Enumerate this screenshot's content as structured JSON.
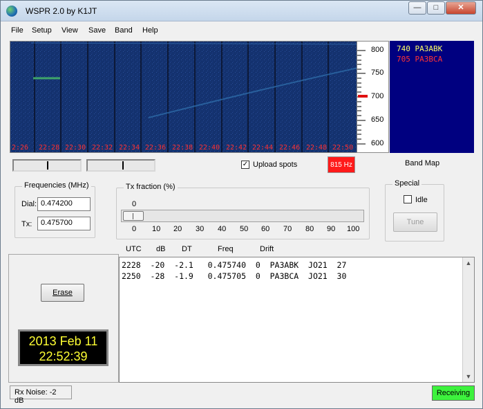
{
  "window": {
    "title": "WSPR 2.0    by K1JT"
  },
  "menu": [
    "File",
    "Setup",
    "View",
    "Save",
    "Band",
    "Help"
  ],
  "waterfall": {
    "time_labels": [
      "2:26",
      "22:28",
      "22:30",
      "22:32",
      "22:34",
      "22:36",
      "22:38",
      "22:40",
      "22:42",
      "22:44",
      "22:46",
      "22:48",
      "22:50"
    ],
    "scale_labels": [
      "800",
      "750",
      "700",
      "650",
      "600"
    ],
    "background_color": "#13306e",
    "label_color": "#ff3030"
  },
  "band_map": {
    "entries": [
      {
        "text": "740  PA3ABK",
        "color": "#ffff66"
      },
      {
        "text": "705  PA3BCA",
        "color": "#ff3333"
      }
    ],
    "label": "Band Map"
  },
  "upload": {
    "label": "Upload spots",
    "checked": true
  },
  "freq_badge": "815 Hz",
  "frequencies": {
    "title": "Frequencies (MHz)",
    "dial_label": "Dial:",
    "dial_value": "0.474200",
    "tx_label": "Tx:",
    "tx_value": "0.475700"
  },
  "tx_fraction": {
    "title": "Tx fraction (%)",
    "current": "0",
    "ticks": [
      "0",
      "10",
      "20",
      "30",
      "40",
      "50",
      "60",
      "70",
      "80",
      "90",
      "100"
    ]
  },
  "special": {
    "title": "Special",
    "idle_label": "Idle",
    "idle_checked": false,
    "tune_label": "Tune"
  },
  "decode_columns": [
    "UTC",
    "dB",
    "DT",
    "Freq",
    "Drift"
  ],
  "decodes": [
    "2228  -20  -2.1   0.475740  0  PA3ABK  JO21  27",
    "2250  -28  -1.9   0.475705  0  PA3BCA  JO21  30"
  ],
  "erase_label": "Erase",
  "clock": {
    "date": "2013 Feb 11",
    "time": "22:52:39"
  },
  "status": {
    "rx_noise": "Rx Noise: -2 dB",
    "state": "Receiving",
    "state_color": "#3df23d"
  }
}
